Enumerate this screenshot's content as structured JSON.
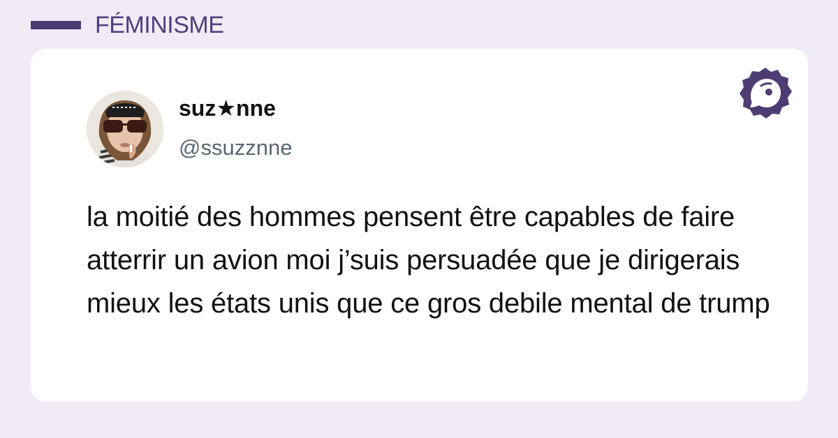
{
  "header": {
    "category": "FÉMINISME"
  },
  "tweet": {
    "author_name": "suz★nne",
    "author_handle": "@ssuzznne",
    "text": "la moitié des hommes pensent être capables de faire atterrir un avion moi j’suis persuadée que je dirigerais mieux les états unis que ce gros debile mental de trump"
  },
  "icons": {
    "logo": "brand-logo-icon",
    "avatar": "profile-photo"
  },
  "colors": {
    "background": "#f1ebf8",
    "accent": "#4f3f7a",
    "card": "#ffffff",
    "text": "#111111",
    "handle": "#5b6670"
  }
}
